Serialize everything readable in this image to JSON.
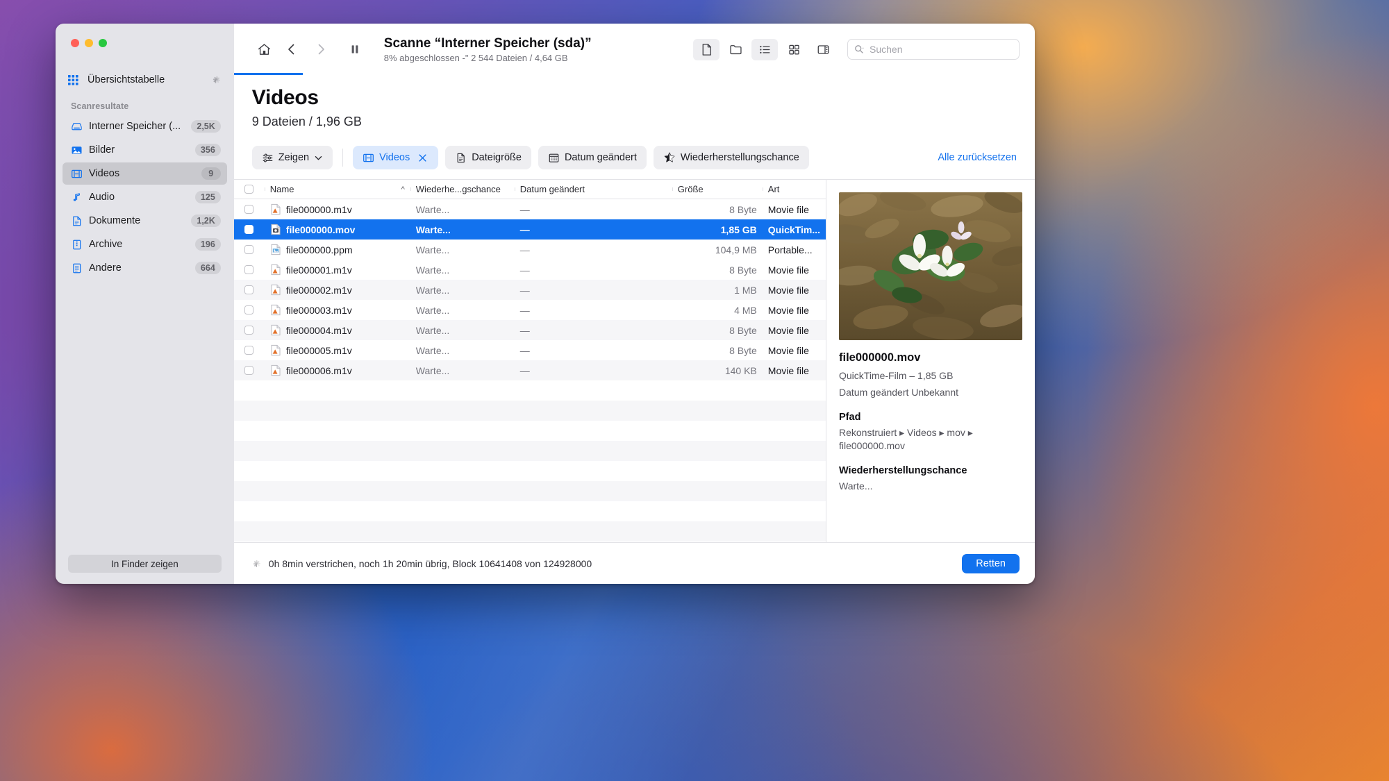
{
  "window": {
    "traffic_lights": [
      "close",
      "minimize",
      "zoom"
    ]
  },
  "sidebar": {
    "overview_label": "Übersichtstabelle",
    "section_title": "Scanresultate",
    "items": [
      {
        "label": "Interner Speicher (...",
        "badge": "2,5K",
        "icon": "hard-drive-icon",
        "active": false
      },
      {
        "label": "Bilder",
        "badge": "356",
        "icon": "photo-icon",
        "active": false
      },
      {
        "label": "Videos",
        "badge": "9",
        "icon": "film-icon",
        "active": true
      },
      {
        "label": "Audio",
        "badge": "125",
        "icon": "music-icon",
        "active": false
      },
      {
        "label": "Dokumente",
        "badge": "1,2K",
        "icon": "document-icon",
        "active": false
      },
      {
        "label": "Archive",
        "badge": "196",
        "icon": "archive-icon",
        "active": false
      },
      {
        "label": "Andere",
        "badge": "664",
        "icon": "other-icon",
        "active": false
      }
    ],
    "finder_button": "In Finder zeigen"
  },
  "toolbar": {
    "home_icon": "home-icon",
    "back_icon": "chevron-left-icon",
    "forward_icon": "chevron-right-icon",
    "pause_icon": "pause-icon",
    "scan_title": "Scanne “Interner Speicher (sda)”",
    "scan_subtitle": "8% abgeschlossen -\" 2 544 Dateien / 4,64 GB",
    "view_icons": [
      "file-view-icon",
      "folder-view-icon",
      "list-view-icon",
      "grid-view-icon",
      "inspector-toggle-icon"
    ],
    "search_placeholder": "Suchen"
  },
  "page": {
    "title": "Videos",
    "subtitle": "9 Dateien / 1,96 GB"
  },
  "filters": {
    "show_label": "Zeigen",
    "chips": [
      {
        "label": "Videos",
        "icon": "film-icon",
        "active": true,
        "closable": true
      },
      {
        "label": "Dateigröße",
        "icon": "document-icon",
        "active": false,
        "closable": false
      },
      {
        "label": "Datum geändert",
        "icon": "calendar-icon",
        "active": false,
        "closable": false
      },
      {
        "label": "Wiederherstellungschance",
        "icon": "star-icon",
        "active": false,
        "closable": false
      }
    ],
    "reset_label": "Alle zurücksetzen"
  },
  "table": {
    "columns": [
      "Name",
      "Wiederhe...gschance",
      "Datum geändert",
      "Größe",
      "Art"
    ],
    "sort_column": "Name",
    "sort_direction": "asc",
    "rows": [
      {
        "name": "file000000.m1v",
        "chance": "Warte...",
        "date": "—",
        "size": "8 Byte",
        "kind": "Movie file",
        "icon": "m1v-file-icon",
        "selected": false
      },
      {
        "name": "file000000.mov",
        "chance": "Warte...",
        "date": "—",
        "size": "1,85 GB",
        "kind": "QuickTim...",
        "icon": "mov-file-icon",
        "selected": true
      },
      {
        "name": "file000000.ppm",
        "chance": "Warte...",
        "date": "—",
        "size": "104,9 MB",
        "kind": "Portable...",
        "icon": "ppm-file-icon",
        "selected": false
      },
      {
        "name": "file000001.m1v",
        "chance": "Warte...",
        "date": "—",
        "size": "8 Byte",
        "kind": "Movie file",
        "icon": "m1v-file-icon",
        "selected": false
      },
      {
        "name": "file000002.m1v",
        "chance": "Warte...",
        "date": "—",
        "size": "1 MB",
        "kind": "Movie file",
        "icon": "m1v-file-icon",
        "selected": false
      },
      {
        "name": "file000003.m1v",
        "chance": "Warte...",
        "date": "—",
        "size": "4 MB",
        "kind": "Movie file",
        "icon": "m1v-file-icon",
        "selected": false
      },
      {
        "name": "file000004.m1v",
        "chance": "Warte...",
        "date": "—",
        "size": "8 Byte",
        "kind": "Movie file",
        "icon": "m1v-file-icon",
        "selected": false
      },
      {
        "name": "file000005.m1v",
        "chance": "Warte...",
        "date": "—",
        "size": "8 Byte",
        "kind": "Movie file",
        "icon": "m1v-file-icon",
        "selected": false
      },
      {
        "name": "file000006.m1v",
        "chance": "Warte...",
        "date": "—",
        "size": "140 KB",
        "kind": "Movie file",
        "icon": "m1v-file-icon",
        "selected": false
      }
    ]
  },
  "preview": {
    "thumbnail_alt": "white-trillium-flower-forest-floor",
    "file_name": "file000000.mov",
    "file_meta": "QuickTime-Film – 1,85 GB",
    "date_modified": "Datum geändert Unbekannt",
    "path_heading": "Pfad",
    "path_value": "Rekonstruiert ▸ Videos ▸ mov ▸ file000000.mov",
    "chance_heading": "Wiederherstellungschance",
    "chance_value": "Warte..."
  },
  "statusbar": {
    "progress_text": "0h 8min verstrichen, noch 1h 20min übrig, Block 10641408 von 124928000",
    "save_button": "Retten"
  },
  "colors": {
    "accent_blue": "#1272ee",
    "selection_blue": "#1272ee",
    "sidebar_bg": "#e4e4e9",
    "chip_bg": "#eeeef1"
  }
}
